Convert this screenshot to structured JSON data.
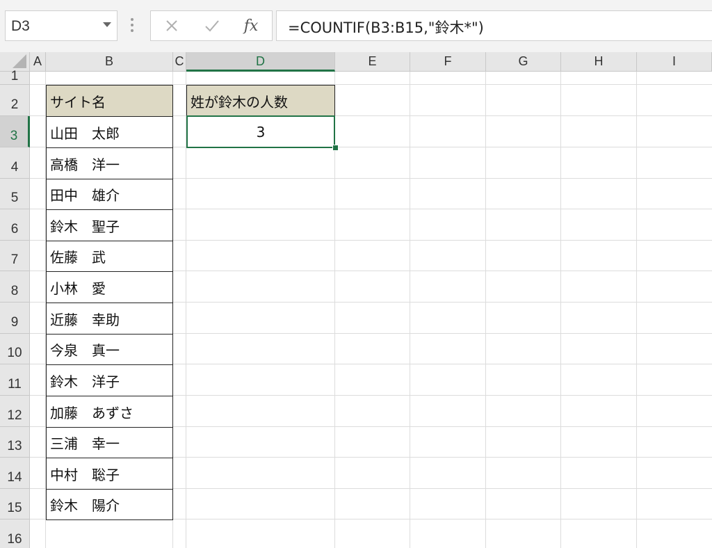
{
  "formula_bar": {
    "name_box": "D3",
    "cancel_symbol": "✕",
    "enter_symbol": "✓",
    "fx_label": "fx",
    "formula": "=COUNTIF(B3:B15,\"鈴木*\")"
  },
  "columns": [
    "A",
    "B",
    "C",
    "D",
    "E",
    "F",
    "G",
    "H",
    "I"
  ],
  "rows": [
    "1",
    "2",
    "3",
    "4",
    "5",
    "6",
    "7",
    "8",
    "9",
    "10",
    "11",
    "12",
    "13",
    "14",
    "15",
    "16"
  ],
  "selected": {
    "column": "D",
    "row": "3"
  },
  "name_table": {
    "header": "サイト名",
    "names": [
      "山田　太郎",
      "高橋　洋一",
      "田中　雄介",
      "鈴木　聖子",
      "佐藤　武",
      "小林　愛",
      "近藤　幸助",
      "今泉　真一",
      "鈴木　洋子",
      "加藤　あずさ",
      "三浦　幸一",
      "中村　聡子",
      "鈴木　陽介"
    ]
  },
  "count_table": {
    "header": "姓が鈴木の人数",
    "value": "3"
  },
  "colors": {
    "header_fill": "#ddd9c4",
    "selection_green": "#217346"
  }
}
